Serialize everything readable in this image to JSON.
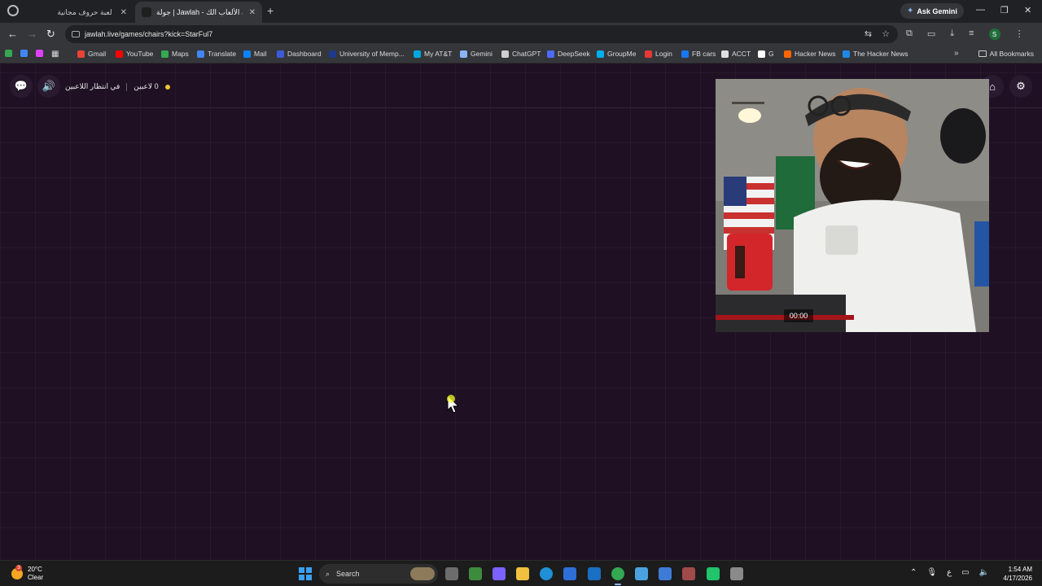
{
  "browser": {
    "tabs": [
      {
        "title": "لعبة حروف مجانية",
        "active": false
      },
      {
        "title": "جولة | Jawlah - منصة الألعاب الك",
        "active": true
      }
    ],
    "new_tab_label": "+",
    "ask_gemini_label": "Ask Gemini",
    "url": "jawlah.live/games/chairs?kick=StarFul7",
    "profile_initial": "S",
    "bookmarks": [
      {
        "label": "Gmail",
        "color": "#ea4335"
      },
      {
        "label": "YouTube",
        "color": "#ff0000"
      },
      {
        "label": "Maps",
        "color": "#34a853"
      },
      {
        "label": "Translate",
        "color": "#4285f4"
      },
      {
        "label": "Mail",
        "color": "#0a84ff"
      },
      {
        "label": "Dashboard",
        "color": "#3b5bdb"
      },
      {
        "label": "University of Memp...",
        "color": "#1e3a8a"
      },
      {
        "label": "My AT&T",
        "color": "#00a8e0"
      },
      {
        "label": "Gemini",
        "color": "#8ab4f8"
      },
      {
        "label": "ChatGPT",
        "color": "#cfcfcf"
      },
      {
        "label": "DeepSeek",
        "color": "#4d6bfe"
      },
      {
        "label": "GroupMe",
        "color": "#00aff0"
      },
      {
        "label": "Login",
        "color": "#e53935"
      },
      {
        "label": "FB cars",
        "color": "#1877f2"
      },
      {
        "label": "ACCT",
        "color": "#e0e0e0"
      },
      {
        "label": "G",
        "color": "#ffffff"
      },
      {
        "label": "Hacker News",
        "color": "#ff6600"
      },
      {
        "label": "The Hacker News",
        "color": "#1e88e5"
      }
    ],
    "all_bookmarks_label": "All Bookmarks"
  },
  "game": {
    "players_count": "0 لاعبين",
    "waiting_status": "في انتظار اللاعبين",
    "status_dot_color": "#f4c430",
    "webcam_timer": "00:00"
  },
  "taskbar": {
    "temperature": "20°C",
    "weather_condition": "Clear",
    "weather_badge": "3",
    "search_placeholder": "Search",
    "time": "1:54 AM",
    "date": "4/17/2026",
    "language_indicator": "ع"
  },
  "colors": {
    "page_background": "#1f1123",
    "browser_chrome": "#35363a",
    "accent_start": "#3aa0f3"
  }
}
